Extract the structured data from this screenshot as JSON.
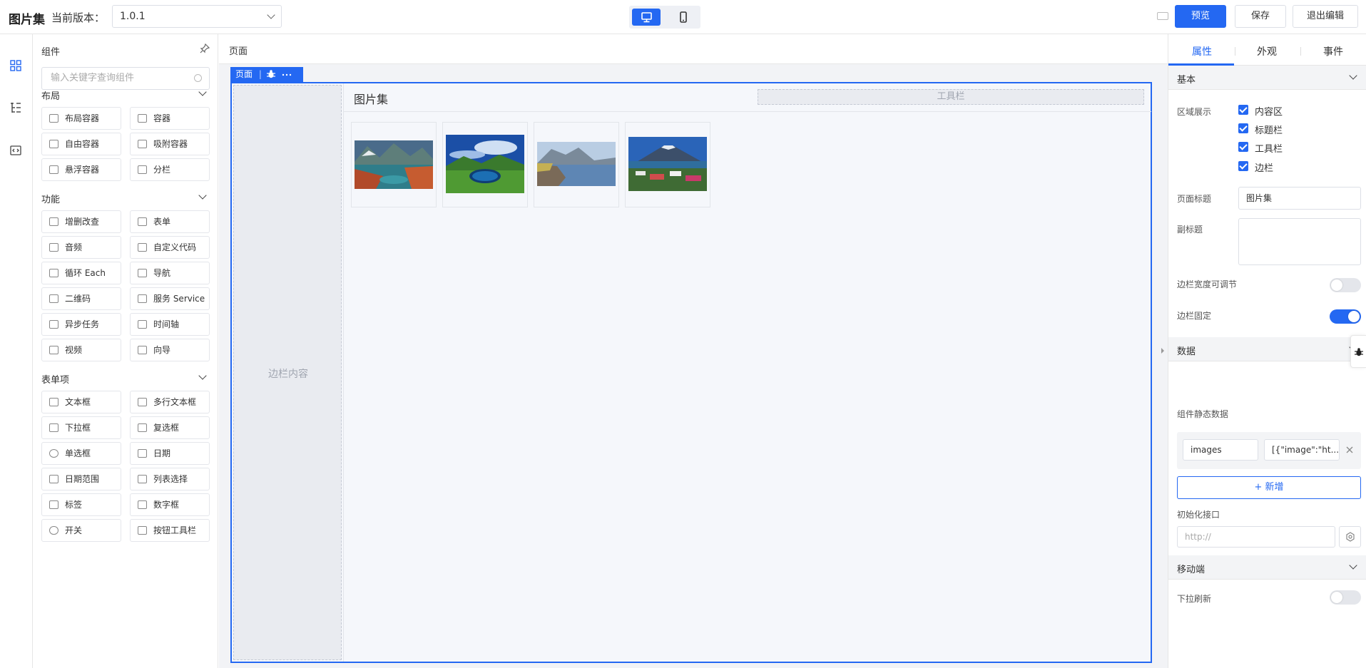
{
  "header": {
    "app_title": "图片集",
    "version_label": "当前版本：",
    "version_value": "1.0.1",
    "device_icons": [
      "desktop-icon",
      "mobile-icon"
    ],
    "preview_label": "预览",
    "save_label": "保存",
    "exit_label": "退出编辑",
    "accent_color": "#2468f2"
  },
  "left_rail": {
    "icons": [
      "components-icon",
      "outline-tree-icon",
      "code-icon"
    ]
  },
  "component_panel": {
    "title": "组件",
    "search_placeholder": "输入关键字查询组件",
    "groups": [
      {
        "title": "布局",
        "items": [
          "布局容器",
          "容器",
          "自由容器",
          "吸附容器",
          "悬浮容器",
          "分栏"
        ]
      },
      {
        "title": "功能",
        "items": [
          "增删改查",
          "表单",
          "音频",
          "自定义代码",
          "循环 Each",
          "导航",
          "二维码",
          "服务 Service",
          "异步任务",
          "时间轴",
          "视频",
          "向导"
        ]
      },
      {
        "title": "表单项",
        "items": [
          "文本框",
          "多行文本框",
          "下拉框",
          "复选框",
          "单选框",
          "日期",
          "日期范围",
          "列表选择",
          "标签",
          "数字框",
          "开关",
          "按钮工具栏"
        ]
      }
    ]
  },
  "canvas": {
    "breadcrumb": "页面",
    "page_tag": "页面",
    "aside_text": "边栏内容",
    "page_title": "图片集",
    "toolbar_text": "工具栏",
    "images": [
      "lake-mountain-photo",
      "crater-lake-photo",
      "mountain-shore-photo",
      "volcano-town-photo"
    ]
  },
  "properties": {
    "tabs": [
      "属性",
      "外观",
      "事件"
    ],
    "active_tab": "属性",
    "basic": {
      "title": "基本",
      "region_label": "区域展示",
      "regions": [
        {
          "label": "内容区",
          "checked": true
        },
        {
          "label": "标题栏",
          "checked": true
        },
        {
          "label": "工具栏",
          "checked": true
        },
        {
          "label": "边栏",
          "checked": true
        }
      ],
      "page_title_label": "页面标题",
      "page_title_value": "图片集",
      "subtitle_label": "副标题",
      "subtitle_value": "",
      "aside_resizable_label": "边栏宽度可调节",
      "aside_resizable_on": false,
      "aside_fixed_label": "边栏固定",
      "aside_fixed_on": true
    },
    "data": {
      "title": "数据",
      "static_label": "组件静态数据",
      "key": "images",
      "value": "[{\"image\":\"ht...",
      "add_label": "新增",
      "init_api_label": "初始化接口",
      "init_api_placeholder": "http://"
    },
    "mobile": {
      "title": "移动端",
      "pull_refresh_label": "下拉刷新",
      "pull_refresh_on": false
    }
  }
}
